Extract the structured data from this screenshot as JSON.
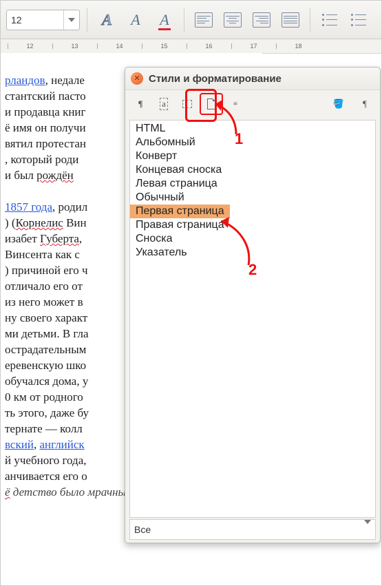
{
  "toolbar": {
    "font_size": "12"
  },
  "ruler": {
    "marks": [
      "12",
      "13",
      "14",
      "15",
      "16",
      "17",
      "18"
    ]
  },
  "document": {
    "lines": [
      {
        "t": "plain",
        "parts": [
          {
            "link": true,
            "txt": "рландов"
          },
          {
            "txt": ", недале"
          }
        ]
      },
      {
        "t": "plain",
        "parts": [
          {
            "txt": "стантский пасто"
          }
        ]
      },
      {
        "t": "plain",
        "parts": [
          {
            "txt": "и продавца книг"
          }
        ]
      },
      {
        "t": "plain",
        "parts": [
          {
            "txt": "ё имя он получи"
          }
        ]
      },
      {
        "t": "plain",
        "parts": [
          {
            "txt": "вятил протестан"
          }
        ]
      },
      {
        "t": "plain",
        "parts": [
          {
            "txt": ", который роди"
          }
        ]
      },
      {
        "t": "plain",
        "parts": [
          {
            "txt": " и был "
          },
          {
            "wavy": true,
            "txt": "рождён"
          }
        ]
      },
      {
        "t": "blank"
      },
      {
        "t": "plain",
        "parts": [
          {
            "link": true,
            "txt": "1857 года"
          },
          {
            "txt": ", родил"
          }
        ]
      },
      {
        "t": "plain",
        "parts": [
          {
            "txt": ") ("
          },
          {
            "wavy": true,
            "txt": "Корнелис"
          },
          {
            "txt": " Вин"
          }
        ]
      },
      {
        "t": "plain",
        "parts": [
          {
            "txt": "изабет "
          },
          {
            "wavy": true,
            "txt": "Губерта"
          },
          {
            "txt": ","
          }
        ]
      },
      {
        "t": "plain",
        "parts": [
          {
            "txt": " Винсента как с"
          }
        ]
      },
      {
        "t": "plain",
        "parts": [
          {
            "txt": ") причиной его ч"
          }
        ]
      },
      {
        "t": "plain",
        "parts": [
          {
            "txt": " отличало его от"
          }
        ]
      },
      {
        "t": "plain",
        "parts": [
          {
            "txt": "из него может в"
          }
        ]
      },
      {
        "t": "plain",
        "parts": [
          {
            "txt": "ну своего характ"
          }
        ]
      },
      {
        "t": "plain",
        "parts": [
          {
            "txt": "ми детьми. В гла"
          }
        ]
      },
      {
        "t": "plain",
        "parts": [
          {
            "txt": "острадательным"
          }
        ]
      },
      {
        "t": "plain",
        "parts": [
          {
            "txt": "еревенскую шко"
          }
        ]
      },
      {
        "t": "plain",
        "parts": [
          {
            "txt": "обучался дома, у"
          }
        ]
      },
      {
        "t": "plain",
        "parts": [
          {
            "txt": "0 км от родного"
          }
        ]
      },
      {
        "t": "plain",
        "parts": [
          {
            "txt": "ть этого, даже бу"
          }
        ]
      },
      {
        "t": "plain",
        "parts": [
          {
            "txt": "тернате — колл"
          }
        ]
      },
      {
        "t": "plain",
        "parts": [
          {
            "link": true,
            "txt": "вский"
          },
          {
            "txt": ", "
          },
          {
            "link": true,
            "txt": "английск"
          }
        ]
      },
      {
        "t": "plain",
        "parts": [
          {
            "txt": "й учебного года,"
          }
        ]
      },
      {
        "t": "plain",
        "parts": [
          {
            "txt": "анчивается его о"
          }
        ]
      },
      {
        "t": "ital",
        "parts": [
          {
            "ital": true,
            "wavy": true,
            "txt": "ё"
          },
          {
            "ital": true,
            "txt": " детство было мрачным, холодным и"
          }
        ]
      }
    ]
  },
  "dialog": {
    "title": "Стили и форматирование",
    "styles": [
      "HTML",
      "Альбомный",
      "Конверт",
      "Концевая сноска",
      "Левая страница",
      "Обычный",
      "Первая страница",
      "Правая страница",
      "Сноска",
      "Указатель"
    ],
    "selected_index": 6,
    "footer_label": "Все"
  },
  "annotations": {
    "label1": "1",
    "label2": "2"
  }
}
